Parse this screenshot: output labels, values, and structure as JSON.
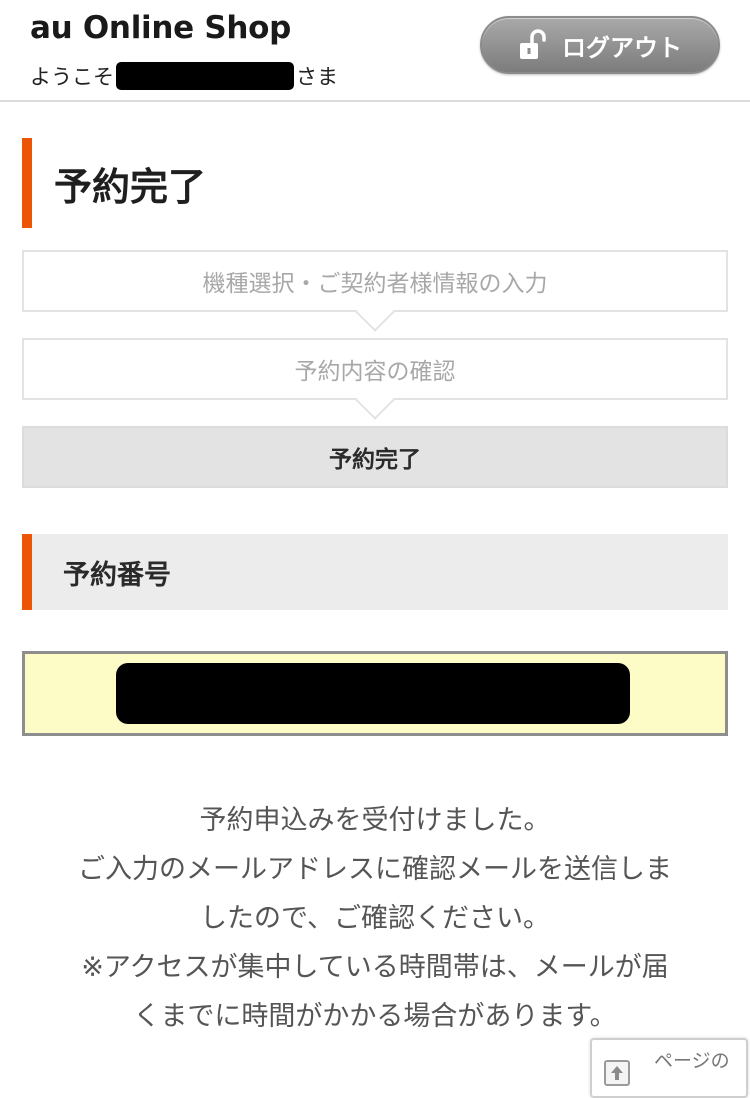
{
  "header": {
    "logo": "au Online Shop",
    "welcome_prefix": "ようこそ",
    "welcome_suffix": "さま",
    "logout_label": "ログアウト"
  },
  "page_title": "予約完了",
  "steps": [
    {
      "label": "機種選択・ご契約者様情報の入力",
      "state": "inactive"
    },
    {
      "label": "予約内容の確認",
      "state": "inactive"
    },
    {
      "label": "予約完了",
      "state": "active"
    }
  ],
  "reservation": {
    "section_title": "予約番号"
  },
  "message": {
    "lines": [
      "予約申込みを受付けました。",
      "ご入力のメールアドレスに確認メールを送信しま",
      "したので、ご確認ください。",
      "※アクセスが集中している時間帯は、メールが届",
      "くまでに時間がかかる場合があります。"
    ]
  },
  "page_top": {
    "label": "ページの"
  },
  "colors": {
    "accent": "#eb5505",
    "number_box_bg": "#fdfbc6",
    "active_step_bg": "#e3e3e3"
  }
}
